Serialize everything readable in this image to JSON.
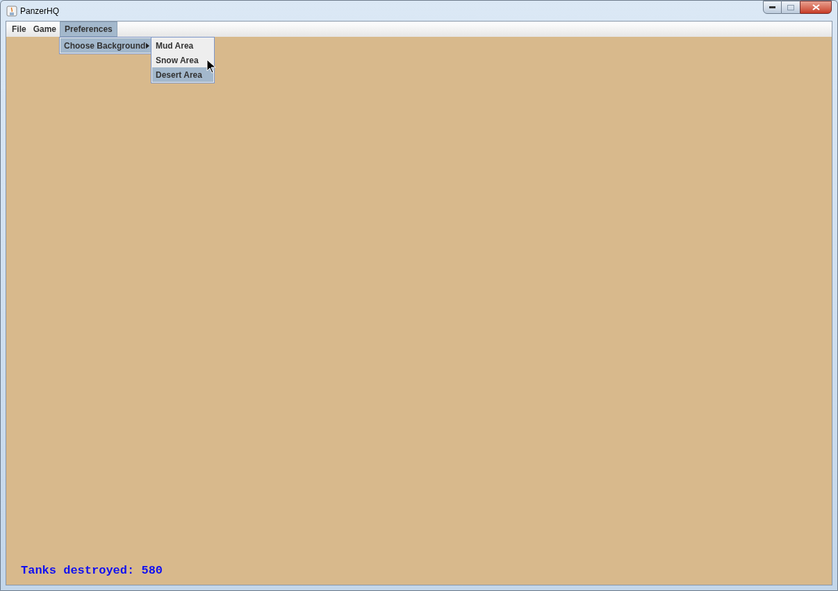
{
  "window": {
    "title": "PanzerHQ"
  },
  "menu_bar": [
    {
      "label": "File",
      "selected": false
    },
    {
      "label": "Game",
      "selected": false
    },
    {
      "label": "Preferences",
      "selected": true
    }
  ],
  "dropdown": {
    "items": [
      {
        "label": "Choose Background",
        "selected": true,
        "submenu": true
      }
    ]
  },
  "submenu": {
    "items": [
      {
        "label": "Mud Area",
        "selected": false
      },
      {
        "label": "Snow Area",
        "selected": false
      },
      {
        "label": "Desert Area",
        "selected": true
      }
    ]
  },
  "score": "Tanks destroyed: 580"
}
